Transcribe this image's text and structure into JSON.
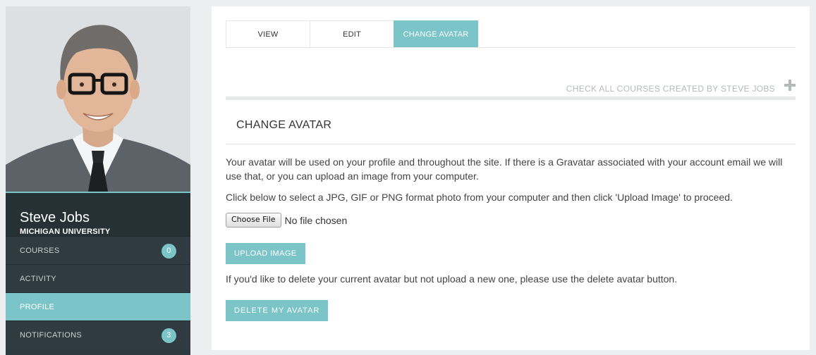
{
  "sidebar": {
    "user_name": "Steve Jobs",
    "user_school": "MICHIGAN UNIVERSITY",
    "items": [
      {
        "label": "COURSES",
        "badge": "0"
      },
      {
        "label": "ACTIVITY"
      },
      {
        "label": "PROFILE",
        "active": true
      },
      {
        "label": "NOTIFICATIONS",
        "badge": "3"
      }
    ]
  },
  "tabs": [
    {
      "label": "VIEW"
    },
    {
      "label": "EDIT"
    },
    {
      "label": "CHANGE AVATAR",
      "active": true
    }
  ],
  "courses_link": "CHECK ALL COURSES CREATED BY STEVE JOBS",
  "section_title": "CHANGE AVATAR",
  "text": {
    "intro": "Your avatar will be used on your profile and throughout the site. If there is a Gravatar associated with your account email we will use that, or you can upload an image from your computer.",
    "instructions": "Click below to select a JPG, GIF or PNG format photo from your computer and then click 'Upload Image' to proceed.",
    "delete_note": "If you'd like to delete your current avatar but not upload a new one, please use the delete avatar button."
  },
  "file_input": {
    "button": "Choose File",
    "status": "No file chosen"
  },
  "buttons": {
    "upload": "UPLOAD IMAGE",
    "delete": "DELETE MY AVATAR"
  },
  "colors": {
    "accent": "#7bc5c9",
    "sidebar_bg": "#2f3b40"
  }
}
